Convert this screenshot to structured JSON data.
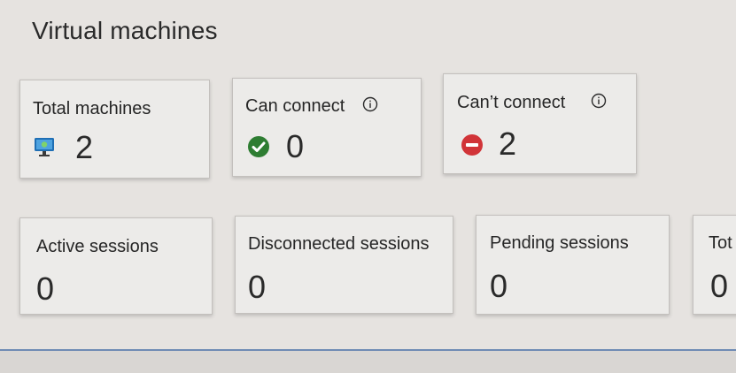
{
  "page": {
    "title": "Virtual machines"
  },
  "vm_cards": [
    {
      "label": "Total machines",
      "value": "2",
      "icon": "monitor-icon"
    },
    {
      "label": "Can connect",
      "value": "0",
      "icon": "check-circle-icon",
      "info": true
    },
    {
      "label": "Can’t connect",
      "value": "2",
      "icon": "blocked-circle-icon",
      "info": true
    }
  ],
  "session_cards": [
    {
      "label": "Active sessions",
      "value": "0"
    },
    {
      "label": "Disconnected sessions",
      "value": "0"
    },
    {
      "label": "Pending sessions",
      "value": "0"
    },
    {
      "label": "Tot",
      "value": "0"
    }
  ],
  "colors": {
    "success": "#2e7d32",
    "error": "#d13438",
    "monitor": "#1f6fb5",
    "divider": "#6f8bb4"
  }
}
